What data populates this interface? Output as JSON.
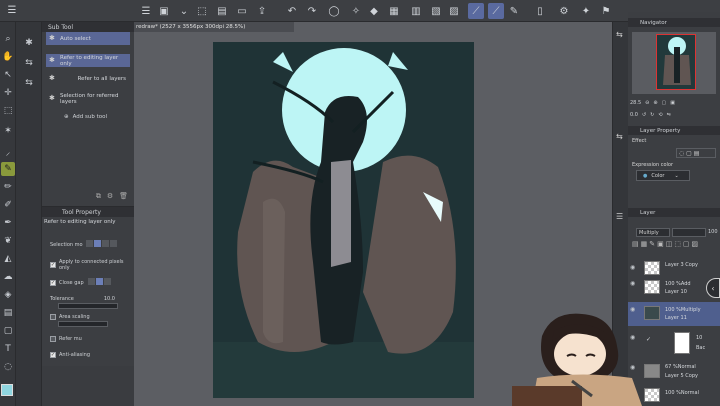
{
  "window": {
    "doc_tab": "redraw* (2527 x 3556px 300dpi 28.5%)"
  },
  "toolbar": {
    "icons": [
      "menu-icon",
      "canvas-icon",
      "new-icon",
      "open-icon",
      "save-icon",
      "export-icon",
      "undo-icon",
      "redo-icon",
      "lasso-icon",
      "clear-icon",
      "fill-icon",
      "transform-icon",
      "grid-icon",
      "guide-icon",
      "ruler-icon",
      "snap-icon",
      "line-icon",
      "pen-icon",
      "mobile-icon",
      "settings-icon"
    ]
  },
  "subtool": {
    "title": "Sub Tool",
    "items": [
      {
        "label": "Auto select",
        "selected": true
      },
      {
        "label": "Refer to editing layer only",
        "selected": true
      },
      {
        "label": "Refer to all layers",
        "selected": false
      },
      {
        "label": "Selection for referred layers",
        "selected": false
      }
    ],
    "add_label": "Add sub tool"
  },
  "tool_property": {
    "title": "Tool Property",
    "subtitle": "Refer to editing layer only",
    "selection_mode_label": "Selection mo",
    "apply_connected": "Apply to connected pixels only",
    "close_gap": "Close gap",
    "tolerance_label": "Tolerance",
    "tolerance_value": "10.0",
    "area_scaling": "Area scaling",
    "refer_multiple": "Refer mu",
    "anti_aliasing": "Anti-aliasing"
  },
  "navigator": {
    "title": "Navigator",
    "zoom": "28.5",
    "angle": "0.0"
  },
  "layer_property": {
    "title": "Layer Property",
    "effect_label": "Effect",
    "expression_color_label": "Expression color",
    "expression_color_value": "Color"
  },
  "layer_panel": {
    "title": "Layer",
    "blend_mode": "Multiply",
    "opacity": "100",
    "layers": [
      {
        "line1": "Layer 3 Copy",
        "line2": "",
        "selected": false
      },
      {
        "line1": "100 %Add",
        "line2": "Layer 10",
        "selected": false
      },
      {
        "line1": "100 %Multiply",
        "line2": "Layer 11",
        "selected": true
      },
      {
        "line1": "10",
        "line2": "Bac",
        "selected": false
      },
      {
        "line1": "67 %Normal",
        "line2": "Layer 5 Copy",
        "selected": false
      },
      {
        "line1": "100 %Normal",
        "line2": "",
        "selected": false
      }
    ]
  },
  "colors": {
    "accent": "#5a6796",
    "canvas_bg": "#1f3336",
    "moon": "#bdf5f5",
    "main_color": "#8fd6e0"
  }
}
